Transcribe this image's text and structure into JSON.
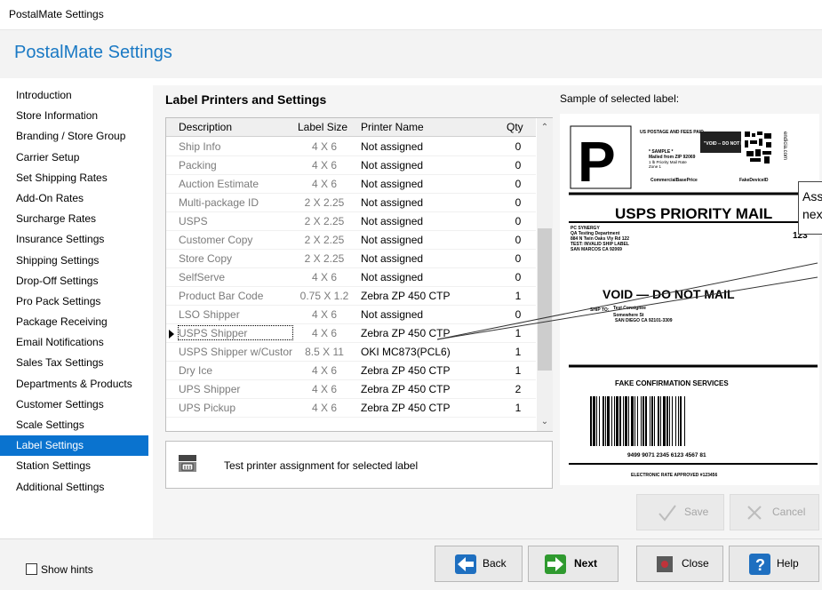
{
  "window": {
    "title": "PostalMate Settings"
  },
  "header": {
    "title": "PostalMate Settings"
  },
  "sidebar": {
    "items": [
      {
        "label": "Introduction"
      },
      {
        "label": "Store Information"
      },
      {
        "label": "Branding / Store Group"
      },
      {
        "label": "Carrier Setup"
      },
      {
        "label": "Set Shipping Rates"
      },
      {
        "label": "Add-On Rates"
      },
      {
        "label": "Surcharge Rates"
      },
      {
        "label": "Insurance Settings"
      },
      {
        "label": "Shipping Settings"
      },
      {
        "label": "Drop-Off Settings"
      },
      {
        "label": "Pro Pack Settings"
      },
      {
        "label": "Package Receiving"
      },
      {
        "label": "Email Notifications"
      },
      {
        "label": "Sales Tax Settings"
      },
      {
        "label": "Departments & Products"
      },
      {
        "label": "Customer Settings"
      },
      {
        "label": "Scale Settings"
      },
      {
        "label": "Label Settings",
        "active": true
      },
      {
        "label": "Station Settings"
      },
      {
        "label": "Additional Settings"
      }
    ]
  },
  "main": {
    "section_title": "Label Printers and Settings",
    "sample_title": "Sample of selected label:",
    "columns": {
      "description": "Description",
      "label_size": "Label Size",
      "printer_name": "Printer Name",
      "qty": "Qty"
    },
    "rows": [
      {
        "description": "Ship Info",
        "size": "4 X 6",
        "printer": "Not assigned",
        "qty": "0"
      },
      {
        "description": "Packing",
        "size": "4 X 6",
        "printer": "Not assigned",
        "qty": "0"
      },
      {
        "description": "Auction Estimate",
        "size": "4 X 6",
        "printer": "Not assigned",
        "qty": "0"
      },
      {
        "description": "Multi-package ID",
        "size": "2 X 2.25",
        "printer": "Not assigned",
        "qty": "0"
      },
      {
        "description": "USPS",
        "size": "2 X 2.25",
        "printer": "Not assigned",
        "qty": "0"
      },
      {
        "description": "Customer Copy",
        "size": "2 X 2.25",
        "printer": "Not assigned",
        "qty": "0"
      },
      {
        "description": "Store Copy",
        "size": "2 X 2.25",
        "printer": "Not assigned",
        "qty": "0"
      },
      {
        "description": "SelfServe",
        "size": "4 X 6",
        "printer": "Not assigned",
        "qty": "0"
      },
      {
        "description": "Product Bar Code",
        "size": "0.75 X 1.2",
        "printer": "Zebra ZP 450 CTP",
        "qty": "1"
      },
      {
        "description": "LSO Shipper",
        "size": "4 X 6",
        "printer": "Not assigned",
        "qty": "0"
      },
      {
        "description": "USPS Shipper",
        "size": "4 X 6",
        "printer": "Zebra ZP 450 CTP",
        "qty": "1",
        "selected": true
      },
      {
        "description": "USPS Shipper w/Custor",
        "size": "8.5 X 11",
        "printer": "OKI MC873(PCL6)",
        "qty": "1"
      },
      {
        "description": "Dry Ice",
        "size": "4 X 6",
        "printer": "Zebra ZP 450 CTP",
        "qty": "1"
      },
      {
        "description": "UPS Shipper",
        "size": "4 X 6",
        "printer": "Zebra ZP 450 CTP",
        "qty": "2"
      },
      {
        "description": "UPS Pickup",
        "size": "4 X 6",
        "printer": "Zebra ZP 450 CTP",
        "qty": "1"
      }
    ],
    "test_label": "Test printer assignment for selected label",
    "sample_label": {
      "big_letter": "P",
      "postage_line": "US POSTAGE AND FEES PAID",
      "void_stamp": "\"VOID -- DO NOT MAIL\"",
      "sample_tag": "* SAMPLE *",
      "mailed_from": "Mailed from ZIP 92069",
      "priority_mail_rate": "1 lb Priority Mail Rate",
      "zone": "Zone 1",
      "commercial_price": "CommercialBasePrice",
      "device_id": "FakeDeviceID",
      "side_text": "endicia.com",
      "service_title": "USPS PRIORITY MAIL",
      "number_fragment": "123",
      "sender": [
        "PC SYNERGY",
        "QA Testing Department",
        "884 N Twin Oaks Vly Rd 122",
        "TEST: INVALID SHIP LABEL",
        "SAN MARCOS CA 92069"
      ],
      "void_text": "VOID — DO NOT MAIL",
      "ship_to_label": "SHIP TO:",
      "recipient_name": "Test Consignee",
      "recipient_street": "Somewhere St",
      "recipient_city": "SAN DIEGO CA 92101-3309",
      "tracking_title": "FAKE CONFIRMATION SERVICES",
      "tracking_number": "9499 9071 2345 6123 4567 81",
      "footer": "ELECTRONIC RATE APPROVED #123456"
    },
    "callout_lines": [
      "Ass",
      "nex"
    ],
    "save_label": "Save",
    "cancel_label": "Cancel"
  },
  "footer": {
    "show_hints_label": "Show hints",
    "back_label": "Back",
    "next_label": "Next",
    "close_label": "Close",
    "help_label": "Help"
  }
}
